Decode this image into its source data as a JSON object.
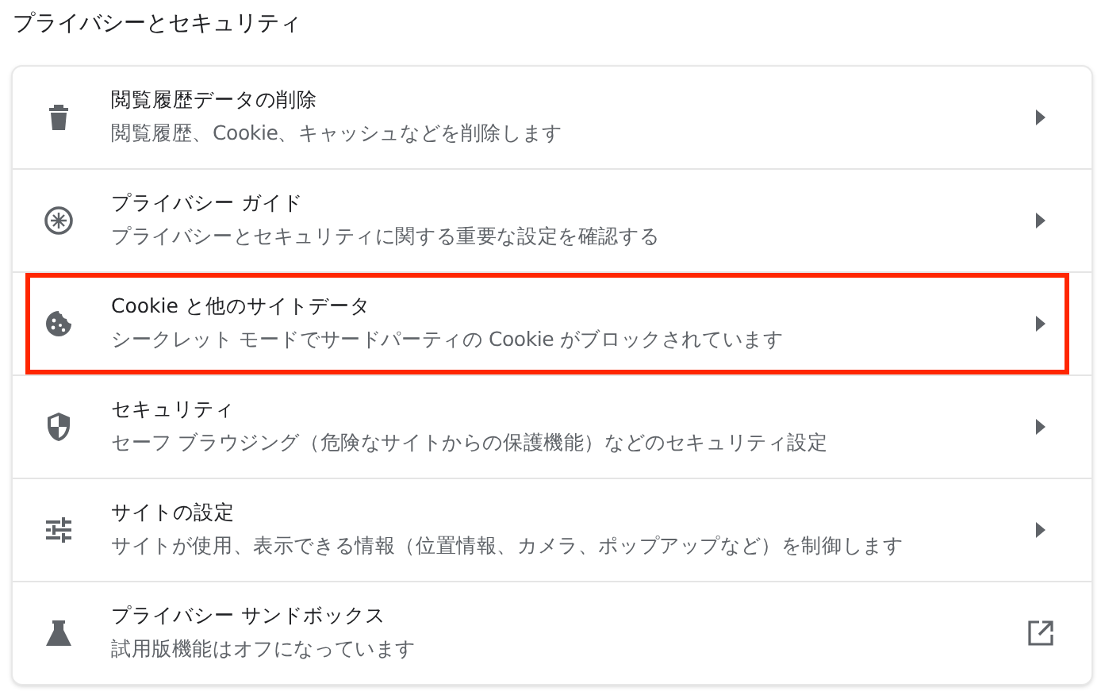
{
  "section_title": "プライバシーとセキュリティ",
  "items": [
    {
      "title": "閲覧履歴データの削除",
      "subtitle": "閲覧履歴、Cookie、キャッシュなどを削除します",
      "kind": "submenu",
      "highlighted": false
    },
    {
      "title": "プライバシー ガイド",
      "subtitle": "プライバシーとセキュリティに関する重要な設定を確認する",
      "kind": "submenu",
      "highlighted": false
    },
    {
      "title": "Cookie と他のサイトデータ",
      "subtitle": "シークレット モードでサードパーティの Cookie がブロックされています",
      "kind": "submenu",
      "highlighted": true
    },
    {
      "title": "セキュリティ",
      "subtitle": "セーフ ブラウジング（危険なサイトからの保護機能）などのセキュリティ設定",
      "kind": "submenu",
      "highlighted": false
    },
    {
      "title": "サイトの設定",
      "subtitle": "サイトが使用、表示できる情報（位置情報、カメラ、ポップアップなど）を制御します",
      "kind": "submenu",
      "highlighted": false
    },
    {
      "title": "プライバシー サンドボックス",
      "subtitle": "試用版機能はオフになっています",
      "kind": "external",
      "highlighted": false
    }
  ]
}
